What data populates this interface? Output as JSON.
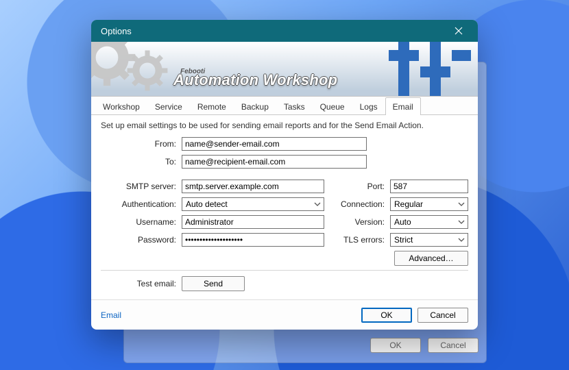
{
  "window": {
    "title": "Options"
  },
  "brand": {
    "small": "Febooti",
    "main": "Automation Workshop"
  },
  "tabs": [
    {
      "label": "Workshop"
    },
    {
      "label": "Service"
    },
    {
      "label": "Remote"
    },
    {
      "label": "Backup"
    },
    {
      "label": "Tasks"
    },
    {
      "label": "Queue"
    },
    {
      "label": "Logs"
    },
    {
      "label": "Email",
      "active": true
    }
  ],
  "description": "Set up email settings to be used for sending email reports and for the Send Email Action.",
  "fields": {
    "from": {
      "label": "From:",
      "value": "name@sender-email.com"
    },
    "to": {
      "label": "To:",
      "value": "name@recipient-email.com"
    },
    "smtp": {
      "label": "SMTP server:",
      "value": "smtp.server.example.com"
    },
    "auth": {
      "label": "Authentication:",
      "value": "Auto detect"
    },
    "user": {
      "label": "Username:",
      "value": "Administrator"
    },
    "pass": {
      "label": "Password:",
      "value": "••••••••••••••••••••"
    },
    "port": {
      "label": "Port:",
      "value": "587"
    },
    "connection": {
      "label": "Connection:",
      "value": "Regular"
    },
    "version": {
      "label": "Version:",
      "value": "Auto"
    },
    "tlserrors": {
      "label": "TLS errors:",
      "value": "Strict"
    },
    "test": {
      "label": "Test email:"
    }
  },
  "buttons": {
    "advanced": "Advanced…",
    "send": "Send",
    "ok": "OK",
    "cancel": "Cancel"
  },
  "footer": {
    "link": "Email"
  },
  "shadow": {
    "ok": "OK",
    "cancel": "Cancel"
  }
}
